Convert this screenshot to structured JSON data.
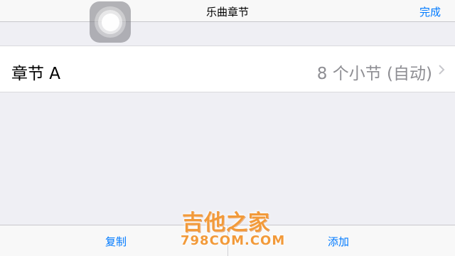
{
  "navbar": {
    "title": "乐曲章节",
    "done_label": "完成"
  },
  "section_list": {
    "items": [
      {
        "name": "章节 A",
        "detail": "8 个小节 (自动)"
      }
    ]
  },
  "toolbar": {
    "copy_label": "复制",
    "add_label": "添加"
  },
  "watermark": {
    "main": "吉他之家",
    "sub": "798COM.COM"
  },
  "colors": {
    "accent": "#007aff",
    "background": "#efeff4",
    "secondary_text": "#8e8e93",
    "watermark": "#f29a3a"
  },
  "icons": {
    "assistive_touch": "assistive-touch-icon",
    "chevron": "chevron-right-icon"
  }
}
